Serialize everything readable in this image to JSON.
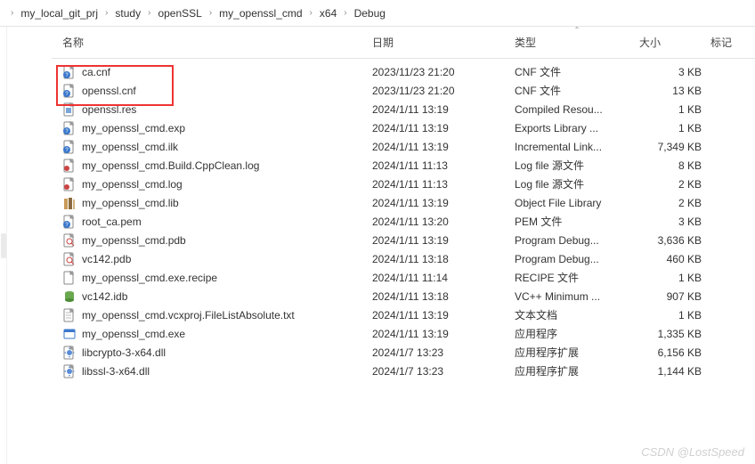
{
  "breadcrumb": [
    "my_local_git_prj",
    "study",
    "openSSL",
    "my_openssl_cmd",
    "x64",
    "Debug"
  ],
  "headers": {
    "name": "名称",
    "date": "日期",
    "type": "类型",
    "size": "大小",
    "tag": "标记"
  },
  "rows": [
    {
      "icon": "cnf",
      "name": "ca.cnf",
      "date": "2023/11/23 21:20",
      "type": "CNF 文件",
      "size": "3 KB"
    },
    {
      "icon": "cnf",
      "name": "openssl.cnf",
      "date": "2023/11/23 21:20",
      "type": "CNF 文件",
      "size": "13 KB"
    },
    {
      "icon": "res",
      "name": "openssl.res",
      "date": "2024/1/11 13:19",
      "type": "Compiled Resou...",
      "size": "1 KB"
    },
    {
      "icon": "exp",
      "name": "my_openssl_cmd.exp",
      "date": "2024/1/11 13:19",
      "type": "Exports Library ...",
      "size": "1 KB"
    },
    {
      "icon": "ilk",
      "name": "my_openssl_cmd.ilk",
      "date": "2024/1/11 13:19",
      "type": "Incremental Link...",
      "size": "7,349 KB"
    },
    {
      "icon": "log",
      "name": "my_openssl_cmd.Build.CppClean.log",
      "date": "2024/1/11 11:13",
      "type": "Log file 源文件",
      "size": "8 KB"
    },
    {
      "icon": "log",
      "name": "my_openssl_cmd.log",
      "date": "2024/1/11 11:13",
      "type": "Log file 源文件",
      "size": "2 KB"
    },
    {
      "icon": "lib",
      "name": "my_openssl_cmd.lib",
      "date": "2024/1/11 13:19",
      "type": "Object File Library",
      "size": "2 KB"
    },
    {
      "icon": "pem",
      "name": "root_ca.pem",
      "date": "2024/1/11 13:20",
      "type": "PEM 文件",
      "size": "3 KB"
    },
    {
      "icon": "pdb",
      "name": "my_openssl_cmd.pdb",
      "date": "2024/1/11 13:19",
      "type": "Program Debug...",
      "size": "3,636 KB"
    },
    {
      "icon": "pdb",
      "name": "vc142.pdb",
      "date": "2024/1/11 13:18",
      "type": "Program Debug...",
      "size": "460 KB"
    },
    {
      "icon": "recipe",
      "name": "my_openssl_cmd.exe.recipe",
      "date": "2024/1/11 11:14",
      "type": "RECIPE 文件",
      "size": "1 KB"
    },
    {
      "icon": "idb",
      "name": "vc142.idb",
      "date": "2024/1/11 13:18",
      "type": "VC++ Minimum ...",
      "size": "907 KB"
    },
    {
      "icon": "txt",
      "name": "my_openssl_cmd.vcxproj.FileListAbsolute.txt",
      "date": "2024/1/11 13:19",
      "type": "文本文档",
      "size": "1 KB"
    },
    {
      "icon": "exe",
      "name": "my_openssl_cmd.exe",
      "date": "2024/1/11 13:19",
      "type": "应用程序",
      "size": "1,335 KB"
    },
    {
      "icon": "dll",
      "name": "libcrypto-3-x64.dll",
      "date": "2024/1/7 13:23",
      "type": "应用程序扩展",
      "size": "6,156 KB"
    },
    {
      "icon": "dll",
      "name": "libssl-3-x64.dll",
      "date": "2024/1/7 13:23",
      "type": "应用程序扩展",
      "size": "1,144 KB"
    }
  ],
  "watermark": "CSDN @LostSpeed"
}
